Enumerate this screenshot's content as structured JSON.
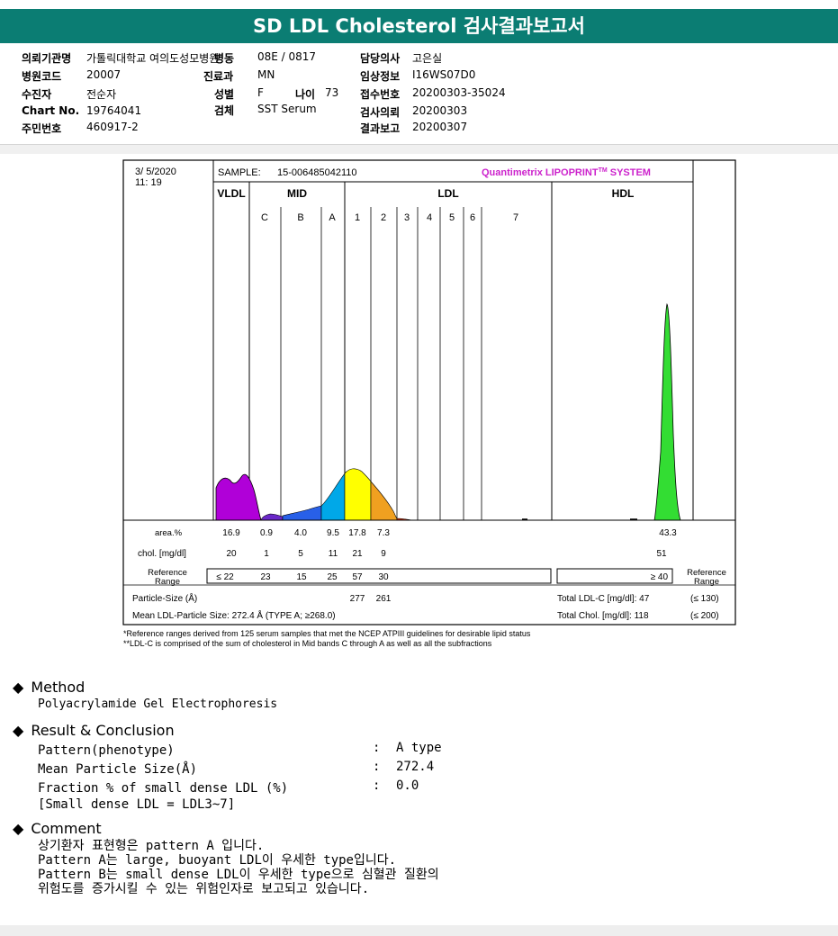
{
  "report": {
    "title": "SD LDL Cholesterol 검사결과보고서"
  },
  "patient": {
    "institution_label": "의뢰기관명",
    "institution": "가톨릭대학교 여의도성모병원",
    "ward_label": "병동",
    "ward": "08E / 0817",
    "doctor_label": "담당의사",
    "doctor": "고은실",
    "hospital_code_label": "병원코드",
    "hospital_code": "20007",
    "dept_label": "진료과",
    "dept": "MN",
    "clinical_label": "임상정보",
    "clinical": "I16WS07D0",
    "patient_label": "수진자",
    "patient_name": "전순자",
    "sex_label": "성별",
    "sex": "F",
    "age_label": "나이",
    "age": "73",
    "receipt_label": "접수번호",
    "receipt": "20200303-35024",
    "chart_label": "Chart No.",
    "chart_no": "19764041",
    "specimen_label": "검체",
    "specimen": "SST Serum",
    "request_label": "검사의뢰",
    "request_date": "20200303",
    "id_label": "주민번호",
    "id_no": "460917-2",
    "result_label": "결과보고",
    "result_date": "20200307"
  },
  "lipoprint": {
    "date": "3/ 5/2020",
    "time": "11: 19",
    "sample_label": "SAMPLE:",
    "sample_id": "15-006485042110",
    "brand": "Quantimetrix LIPOPRINT",
    "brand_tm": "TM",
    "brand_suffix": " SYSTEM",
    "groups": [
      "VLDL",
      "MID",
      "LDL",
      "HDL"
    ],
    "subbands": [
      "C",
      "B",
      "A",
      "1",
      "2",
      "3",
      "4",
      "5",
      "6",
      "7"
    ],
    "row_labels": {
      "area": "area.%",
      "chol": "chol. [mg/dl]",
      "ref1": "Reference",
      "ref2": "Range",
      "particle": "Particle-Size (Å)",
      "mean": "Mean LDL-Particle Size:  272.4 Å  (TYPE A; ≥268.0)",
      "total_ldl": "Total LDL-C [mg/dl]:  47",
      "total_ldl_ref": "(≤ 130)",
      "total_chol": "Total Chol. [mg/dl]:   118",
      "total_chol_ref": "(≤ 200)"
    },
    "area": [
      "16.9",
      "0.9",
      "4.0",
      "9.5",
      "17.8",
      "7.3",
      "43.3"
    ],
    "chol": [
      "20",
      "1",
      "5",
      "11",
      "21",
      "9",
      "51"
    ],
    "ref": [
      "≤  22",
      "23",
      "15",
      "25",
      "57",
      "30",
      "≥ 40"
    ],
    "particle_size": [
      "277",
      "261"
    ],
    "footnote1": "*Reference ranges derived from 125 serum samples that met the NCEP ATPIII guidelines for desirable lipid status",
    "footnote2": "**LDL-C is comprised of the sum of cholesterol in Mid bands C through A as well as all the subfractions",
    "colors": {
      "vldl": "#b000d8",
      "mid_c": "#6a28c8",
      "mid_b": "#2860e8",
      "mid_a": "#00a8e8",
      "ldl1": "#ffff00",
      "ldl2": "#f0a020",
      "ldl3": "#c83010",
      "hdl": "#33dd33",
      "brand": "#cc22cc"
    }
  },
  "method": {
    "heading": "Method",
    "text": "Polyacrylamide Gel Electrophoresis"
  },
  "result": {
    "heading": "Result & Conclusion",
    "rows": [
      {
        "label": "Pattern(phenotype)",
        "sep": ":",
        "value": "A type"
      },
      {
        "label": "Mean Particle Size(Å)",
        "sep": ":",
        "value": "272.4"
      },
      {
        "label": "Fraction % of small dense LDL (%)",
        "sep": ":",
        "value": "0.0"
      }
    ],
    "note": "[Small dense LDL = LDL3~7]"
  },
  "comment": {
    "heading": "Comment",
    "lines": [
      "상기환자 표현형은 pattern A 입니다.",
      "Pattern A는 large, buoyant LDL이 우세한 type입니다.",
      "Pattern B는 small dense LDL이 우세한 type으로 심혈관 질환의",
      "위험도를 증가시킬 수 있는 위험인자로 보고되고 있습니다."
    ]
  }
}
